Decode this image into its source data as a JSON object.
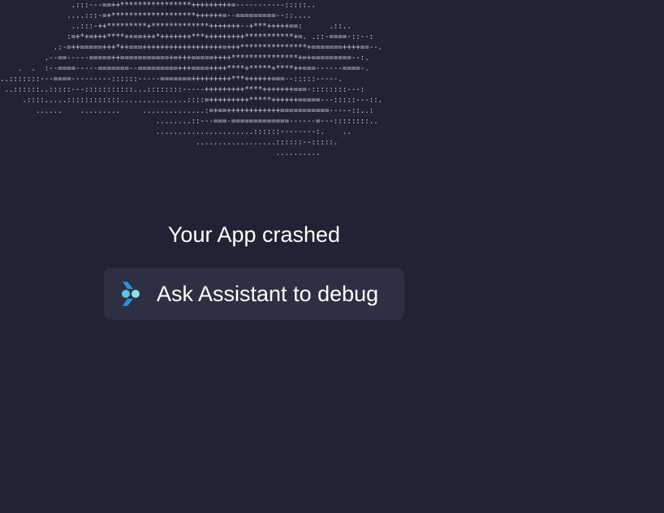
{
  "ascii_art": {
    "lines": [
      "                .:::---==++****************+++++++++=-----------:::::..",
      "               ....:::-=+*******************++++++=--=========--::....",
      "                ..:::-++*********+*************+++++++--+***+++++==:      .::..",
      "               :=+*+=+++****++==+++*+++++++***+++++++++***********+=. .::-====-::--:",
      "            .:-=++=====+++*++===++++++++++++++++++=+++***************+=======++++==--.",
      "          .--==-----=====++===========+=+++=====++++***************+=+=========--:.",
      "    .  .  :--====-----=======--=========+++====++++****+*****+****++===------====-.",
      "..:::::::---====---------::::::-----=======+++++++++***++++++===--:::::-----.",
      " ..::::::..:::::---:::::::::::...::::::::-----+++++++++****+++++++===-::::::::---:",
      "     .::::.....::::::::::::...............::::=+++++++++*****++++++=====---:::::---::.",
      "        ......    .........     ..............:=+==++++++++++++===========-----::..:",
      "                                   ........::---===-=============------=---::::::::..",
      "                                   ......................::::::--------:.    ..",
      "                                            ..................::::::--:::::.",
      "                                                              .........."
    ]
  },
  "message": {
    "title": "Your App crashed"
  },
  "debug_button": {
    "label": "Ask Assistant to debug",
    "icon": "assistant-icon",
    "icon_colors": [
      "#2f8fd6",
      "#56c2e6",
      "#8fdcf0"
    ]
  },
  "colors": {
    "background": "#1f2333",
    "button_background": "#2c3042",
    "text": "#ffffff",
    "ascii": "#c9ccd6"
  }
}
